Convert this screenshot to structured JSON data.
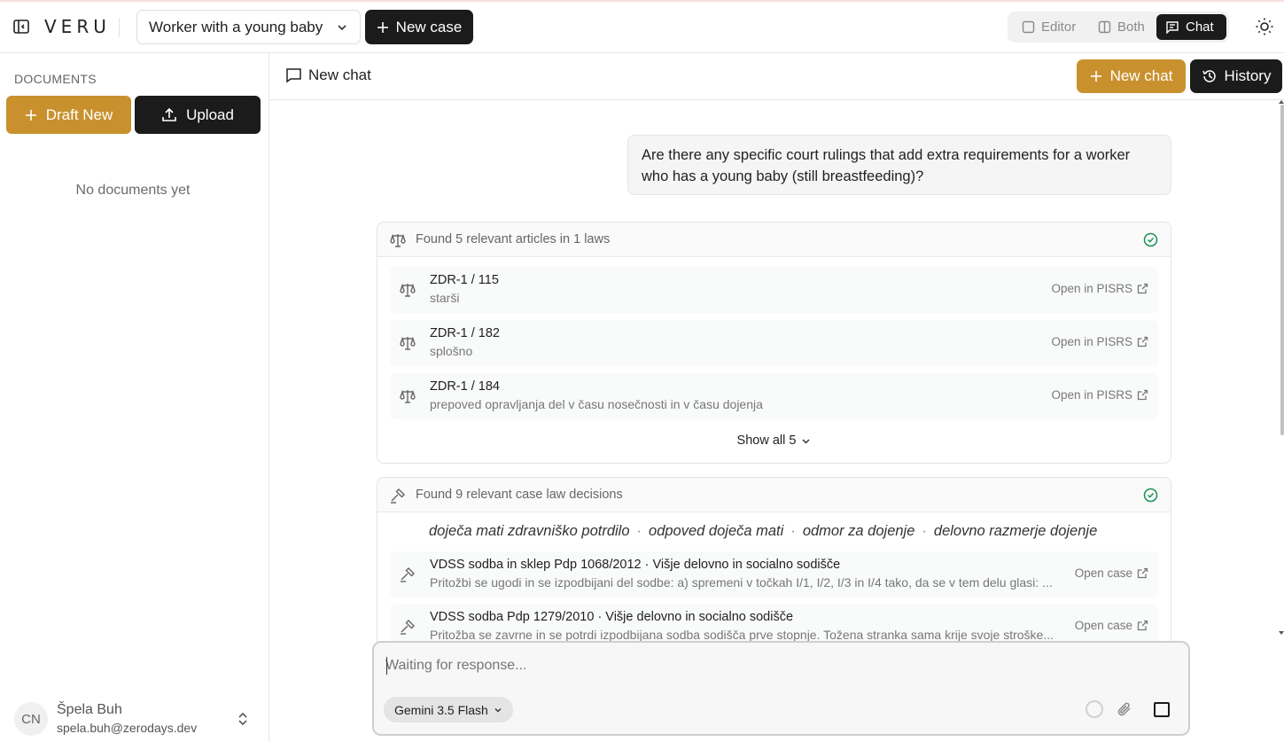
{
  "app": {
    "logo": "VERU"
  },
  "header": {
    "case_selector": "Worker with a young baby",
    "new_case_label": "New case",
    "views": {
      "editor": "Editor",
      "both": "Both",
      "chat": "Chat"
    },
    "active_view": "Chat"
  },
  "sidebar": {
    "title": "DOCUMENTS",
    "draft_label": "Draft New",
    "upload_label": "Upload",
    "empty_text": "No documents yet",
    "user": {
      "initials": "CN",
      "name": "Špela Buh",
      "email": "spela.buh@zerodays.dev"
    }
  },
  "chat": {
    "title": "New chat",
    "new_chat_label": "New chat",
    "history_label": "History",
    "user_message": "Are there any specific court rulings that add extra requirements for a worker who has a young baby (still breastfeeding)?",
    "laws": {
      "header": "Found 5 relevant articles in 1 laws",
      "items": [
        {
          "title": "ZDR-1 / 115",
          "subtitle": "starši",
          "link": "Open in PISRS"
        },
        {
          "title": "ZDR-1 / 182",
          "subtitle": "splošno",
          "link": "Open in PISRS"
        },
        {
          "title": "ZDR-1 / 184",
          "subtitle": "prepoved opravljanja del v času nosečnosti in v času dojenja",
          "link": "Open in PISRS"
        }
      ],
      "show_all": "Show all 5"
    },
    "cases": {
      "header": "Found 9 relevant case law decisions",
      "queries": [
        "doječa mati zdravniško potrdilo",
        "odpoved doječa mati",
        "odmor za dojenje",
        "delovno razmerje dojenje"
      ],
      "items": [
        {
          "title": "VDSS sodba in sklep Pdp 1068/2012 · Višje delovno in socialno sodišče",
          "subtitle": "Pritožbi se ugodi in se izpodbijani del sodbe: a) spremeni v točkah I/1, I/2, I/3 in I/4 tako, da se v tem delu glasi: ...",
          "link": "Open case"
        },
        {
          "title": "VDSS sodba Pdp 1279/2010 · Višje delovno in socialno sodišče",
          "subtitle": "Pritožba se zavrne in se potrdi izpodbijana sodba sodišča prve stopnje. Tožena stranka sama krije svoje stroške...",
          "link": "Open case"
        }
      ]
    },
    "composer": {
      "placeholder": "Waiting for response...",
      "model": "Gemini 3.5 Flash"
    }
  },
  "colors": {
    "accent": "#c9912e",
    "dark": "#1b1b1b",
    "success": "#1a8f5a"
  }
}
